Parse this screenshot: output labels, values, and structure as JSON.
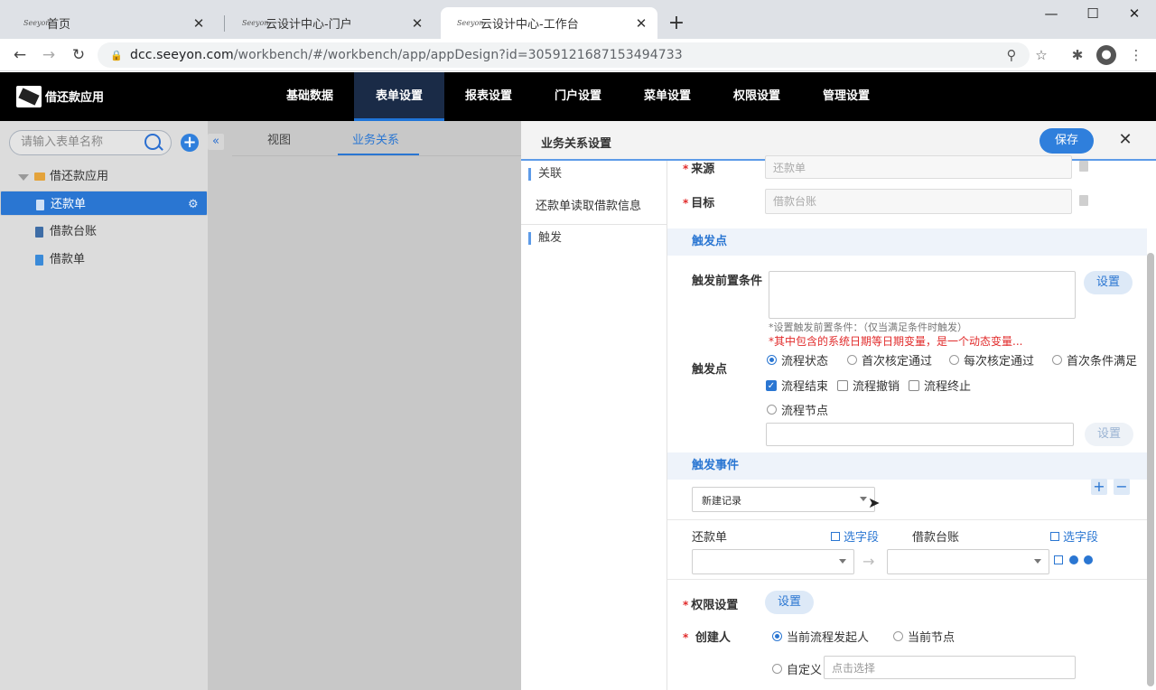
{
  "browser": {
    "tabs": [
      {
        "title": "首页",
        "favicon": "seeyon-logo-icon"
      },
      {
        "title": "云设计中心-门户",
        "favicon": "seeyon-logo-icon"
      },
      {
        "title": "云设计中心-工作台",
        "favicon": "seeyon-logo-icon"
      }
    ],
    "favicon_text": "Seeyon",
    "new_tab": "+",
    "url_host": "dcc.seeyon.com",
    "url_path": "/workbench/#/workbench/app/appDesign?id=3059121687153494733"
  },
  "app": {
    "name": "借还款应用",
    "menu": [
      "基础数据",
      "表单设置",
      "报表设置",
      "门户设置",
      "菜单设置",
      "权限设置",
      "管理设置"
    ],
    "active_menu": "表单设置"
  },
  "left": {
    "search_placeholder": "请输入表单名称",
    "tree": [
      {
        "label": "借还款应用",
        "type": "folder"
      },
      {
        "label": "还款单",
        "type": "form",
        "selected": true
      },
      {
        "label": "借款台账",
        "type": "form"
      },
      {
        "label": "借款单",
        "type": "form"
      }
    ]
  },
  "middle": {
    "tabs": [
      "视图",
      "业务关系"
    ],
    "active_tab": "业务关系"
  },
  "drawer": {
    "title": "业务关系设置",
    "save": "保存",
    "sections": {
      "relation": "关联",
      "relation_item": "还款单读取借款信息",
      "trigger": "触发"
    },
    "source_label": "来源",
    "source_value": "还款单",
    "target_label": "目标",
    "target_value": "借款台账",
    "trigger_point_header": "触发点",
    "pre_condition_label": "触发前置条件",
    "set_label": "设置",
    "hint": "*设置触发前置条件：（仅当满足条件时触发）",
    "warn": "*其中包含的系统日期等日期变量，是一个动态变量...",
    "trigger_point_label": "触发点",
    "radios": [
      "流程状态",
      "首次核定通过",
      "每次核定通过",
      "首次条件满足"
    ],
    "checks": [
      {
        "label": "流程结束",
        "checked": true
      },
      {
        "label": "流程撤销",
        "checked": false
      },
      {
        "label": "流程终止",
        "checked": false
      }
    ],
    "node_radio": "流程节点",
    "event_header": "触发事件",
    "event_value": "新建记录",
    "map_left": "还款单",
    "map_right": "借款台账",
    "select_field": "选字段",
    "permission_label": "权限设置",
    "creator_label": "创建人",
    "creator_options": [
      "当前流程发起人",
      "当前节点"
    ],
    "custom_label": "自定义",
    "custom_placeholder": "点击选择"
  },
  "colors": {
    "accent": "#2a76d2",
    "header_bg": "#000000",
    "required": "#e12b2b"
  }
}
